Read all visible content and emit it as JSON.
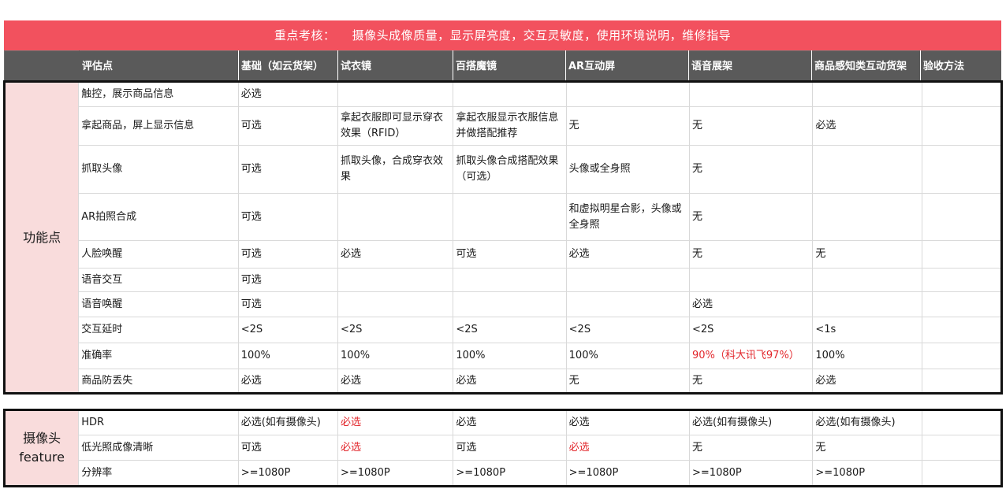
{
  "banner": {
    "lead": "重点考核：",
    "text": "摄像头成像质量，显示屏亮度，交互灵敏度，使用环境说明，维修指导"
  },
  "header": [
    "",
    "评估点",
    "基础（如云货架）",
    "试衣镜",
    "百搭魔镜",
    "AR互动屏",
    "语音展架",
    "商品感知类互动货架",
    "验收方法"
  ],
  "feature_group": "功能点",
  "feature_rows": [
    {
      "label": "触控，展示商品信息",
      "cells": [
        "必选",
        "",
        "",
        "",
        "",
        "",
        ""
      ]
    },
    {
      "label": "拿起商品，屏上显示信息",
      "cells": [
        "可选",
        "拿起衣服即可显示穿衣效果（RFID）",
        "拿起衣服显示衣服信息并做搭配推荐",
        "无",
        "无",
        "必选",
        ""
      ]
    },
    {
      "label": "抓取头像",
      "cells": [
        "可选",
        "抓取头像，合成穿衣效果",
        "抓取头像合成搭配效果（可选）",
        "头像或全身照",
        "无",
        "",
        ""
      ]
    },
    {
      "label": "AR拍照合成",
      "cells": [
        "可选",
        "",
        "",
        "和虚拟明星合影，头像或全身照",
        "无",
        "",
        ""
      ]
    },
    {
      "label": "人脸唤醒",
      "cells": [
        "可选",
        "必选",
        "可选",
        "必选",
        "无",
        "无",
        ""
      ]
    },
    {
      "label": "语音交互",
      "cells": [
        "可选",
        "",
        "",
        "",
        "",
        "",
        ""
      ]
    },
    {
      "label": "语音唤醒",
      "cells": [
        "可选",
        "",
        "",
        "",
        "必选",
        "",
        ""
      ]
    },
    {
      "label": "交互延时",
      "cells": [
        "<2S",
        "<2S",
        "<2S",
        "<2S",
        "<2S",
        "<1s",
        ""
      ]
    },
    {
      "label": "准确率",
      "cells": [
        "100%",
        "100%",
        "100%",
        "100%",
        "90%（科大讯飞97%）",
        "100%",
        ""
      ]
    },
    {
      "label": "商品防丢失",
      "cells": [
        "必选",
        "必选",
        "必选",
        "无",
        "无",
        "必选",
        ""
      ]
    }
  ],
  "camera_group_line1": "摄像头",
  "camera_group_line2": "feature",
  "camera_rows": [
    {
      "label": "HDR",
      "cells": [
        "必选(如有摄像头)",
        "必选",
        "必选",
        "必选",
        "必选(如有摄像头)",
        "必选(如有摄像头)",
        ""
      ]
    },
    {
      "label": "低光照成像清晰",
      "cells": [
        "可选",
        "必选",
        "可选",
        "必选",
        "无",
        "无",
        ""
      ]
    },
    {
      "label": "分辨率",
      "cells": [
        ">=1080P",
        ">=1080P",
        ">=1080P",
        ">=1080P",
        ">=1080P",
        ">=1080P",
        ""
      ]
    }
  ],
  "colors": {
    "banner": "#f2515e",
    "header": "#5a5a5a",
    "group": "#f9dcdc",
    "highlight": "#e2262b"
  }
}
